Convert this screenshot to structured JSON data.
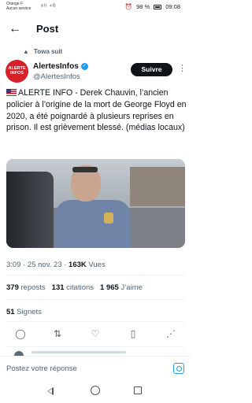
{
  "status_bar": {
    "carrier_line1": "Orange F",
    "carrier_line2": "Aucun service",
    "signal_icons": "ᵃᴵˡ ⁴ᴳ",
    "battery": "98 %",
    "time": "09:08"
  },
  "header": {
    "back_icon": "arrow-left-icon",
    "title": "Post"
  },
  "repost": {
    "icon": "person-icon",
    "label": "Towa suit"
  },
  "author": {
    "avatar_text": "ALERTE INFOS",
    "name": "AlertesInfos",
    "handle": "@AlertesInfos",
    "verified": true,
    "follow_label": "Suivre",
    "more_label": "⋮"
  },
  "tweet": {
    "text": "ALERTE INFO - Derek Chauvin, l’ancien policier à l’origine de la mort de George Floyd en 2020, a été poignardé à plusieurs reprises en prison. Il est grièvement blessé. (médias locaux)"
  },
  "meta": {
    "time": "3:09 · 25 nov. 23 · ",
    "views_count": "163K",
    "views_label": " Vues"
  },
  "stats": {
    "reposts_count": "379",
    "reposts_label": "reposts",
    "citations_count": "131",
    "citations_label": "citations",
    "likes_count": "1 965",
    "likes_label": "J’aime",
    "bookmarks_count": "51",
    "bookmarks_label": "Signets"
  },
  "actions": [
    {
      "name": "reply-icon",
      "glyph": "◯"
    },
    {
      "name": "repost-icon",
      "glyph": "⇅"
    },
    {
      "name": "like-icon",
      "glyph": "♡"
    },
    {
      "name": "bookmark-icon",
      "glyph": "▯"
    },
    {
      "name": "share-icon",
      "glyph": "⋰"
    }
  ],
  "reply_bar": {
    "placeholder": "Postez votre réponse"
  },
  "colors": {
    "accent": "#1d9bf0",
    "avatar_red": "#d8202a",
    "text": "#0f1419",
    "secondary": "#536471"
  }
}
